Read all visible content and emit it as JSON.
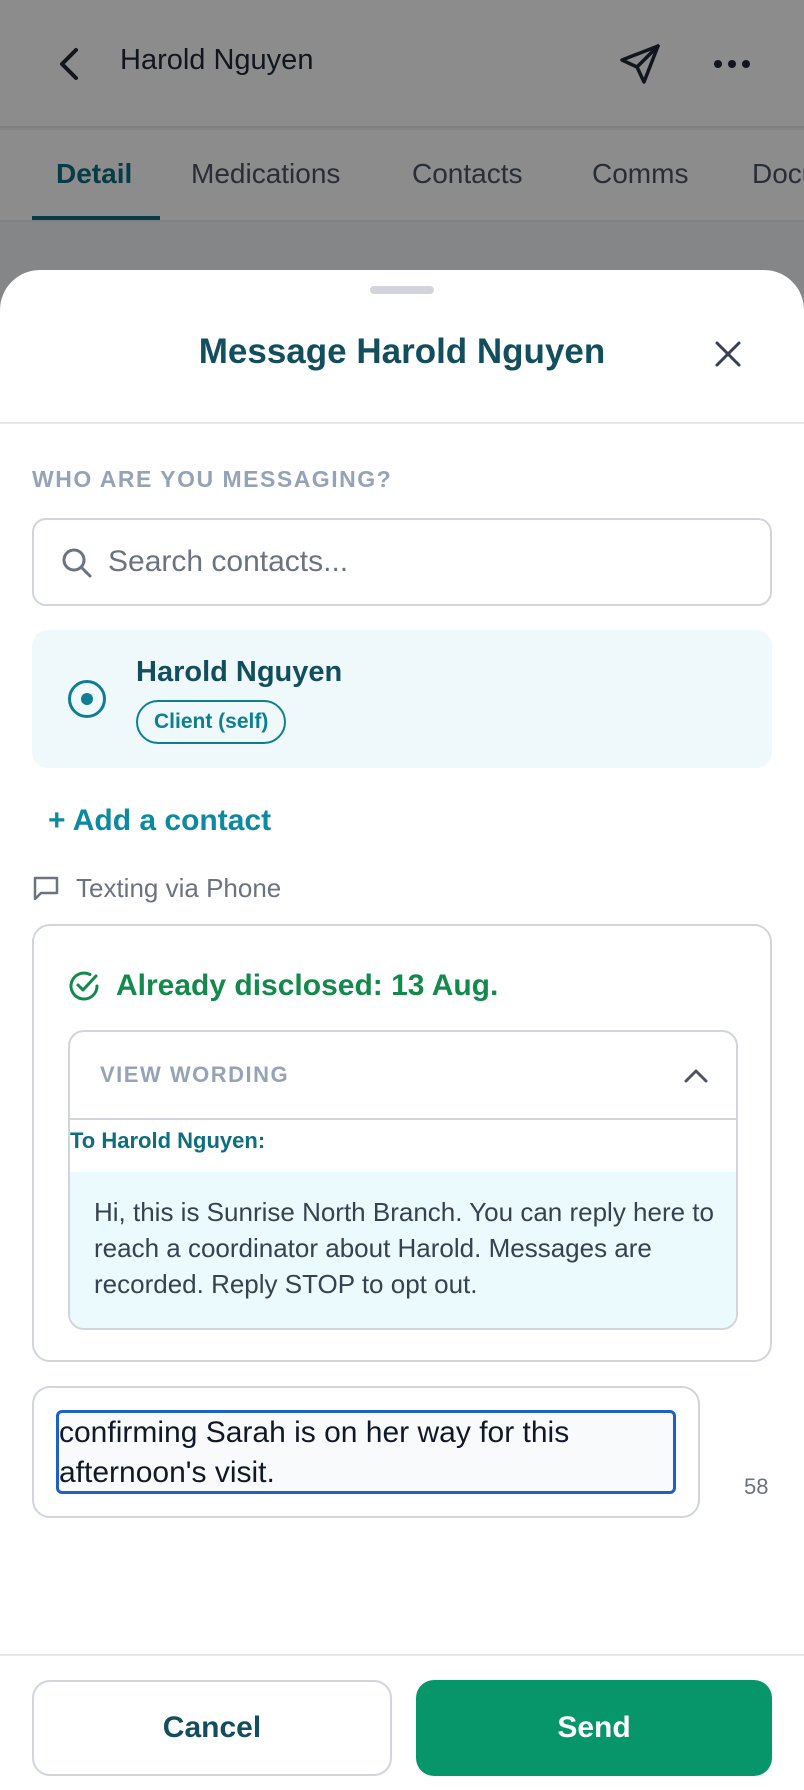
{
  "header": {
    "title": "Harold Nguyen",
    "icons": {
      "back": "chevron-left-icon",
      "send": "paper-plane-icon",
      "more": "more-horizontal-icon"
    }
  },
  "tabs": [
    {
      "label": "Detail",
      "active": true
    },
    {
      "label": "Medications"
    },
    {
      "label": "Contacts"
    },
    {
      "label": "Comms"
    },
    {
      "label": "Documents"
    }
  ],
  "sheet": {
    "title": "Message Harold Nguyen",
    "section_label": "WHO ARE YOU MESSAGING?",
    "search": {
      "placeholder": "Search contacts...",
      "value": ""
    },
    "selected_contact": {
      "name": "Harold Nguyen",
      "badge": "Client (self)"
    },
    "add_contact_label": "+ Add a contact",
    "channel_label": "Texting via Phone",
    "disclosure": {
      "status": "Already disclosed: 13 Aug.",
      "wording_label": "VIEW WORDING",
      "to_label": "To Harold Nguyen:",
      "body": "Hi, this is Sunrise North Branch. You can reply here to reach a coordinator about Harold. Messages are recorded. Reply STOP to opt out."
    },
    "compose": {
      "value": "confirming Sarah is on her way for this afternoon's visit.",
      "char_count": "58"
    },
    "buttons": {
      "cancel": "Cancel",
      "send": "Send"
    }
  },
  "colors": {
    "primary_teal": "#0e6e80",
    "success_green": "#138a4c",
    "send_button": "#06966a",
    "focus_blue": "#1e5fc9"
  }
}
